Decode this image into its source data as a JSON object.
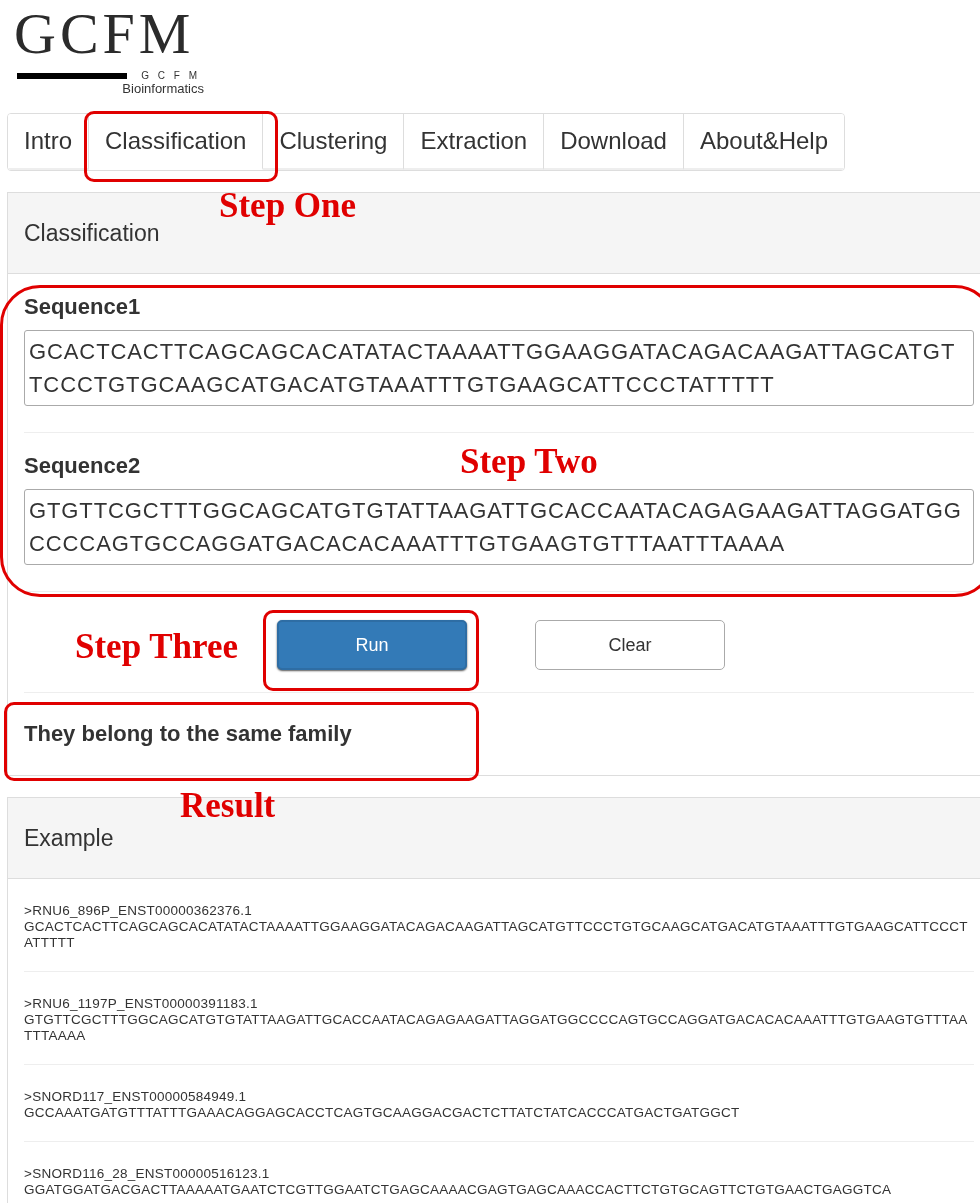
{
  "logo": {
    "mark": "GCFM",
    "small": "G C F M",
    "subtitle": "Bioinformatics"
  },
  "tabs": [
    {
      "label": "Intro",
      "selected": false
    },
    {
      "label": "Classification",
      "selected": true
    },
    {
      "label": "Clustering",
      "selected": false
    },
    {
      "label": "Extraction",
      "selected": false
    },
    {
      "label": "Download",
      "selected": false
    },
    {
      "label": "About&Help",
      "selected": false
    }
  ],
  "classification_panel": {
    "title": "Classification",
    "sequences": [
      {
        "label": "Sequence1",
        "value": "GCACTCACTTCAGCAGCACATATACTAAAATTGGAAGGATACAGACAAGATTAGCATGTTCCCTGTGCAAGCATGACATGTAAATTTGTGAAGCATTCCCTATTTTT"
      },
      {
        "label": "Sequence2",
        "value": "GTGTTCGCTTTGGCAGCATGTGTATTAAGATTGCACCAATACAGAGAAGATTAGGATGGCCCCAGTGCCAGGATGACACACAAATTTGTGAAGTGTTTAATTTAAAA"
      }
    ],
    "buttons": [
      {
        "label": "Run",
        "kind": "primary"
      },
      {
        "label": "Clear",
        "kind": "default"
      }
    ],
    "result": "They belong to the same family"
  },
  "example_panel": {
    "title": "Example",
    "items": [
      {
        "name": ">RNU6_896P_ENST00000362376.1",
        "sequence": "GCACTCACTTCAGCAGCACATATACTAAAATTGGAAGGATACAGACAAGATTAGCATGTTCCCTGTGCAAGCATGACATGTAAATTTGTGAAGCATTCCCTATTTTT"
      },
      {
        "name": ">RNU6_1197P_ENST00000391183.1",
        "sequence": "GTGTTCGCTTTGGCAGCATGTGTATTAAGATTGCACCAATACAGAGAAGATTAGGATGGCCCCAGTGCCAGGATGACACACAAATTTGTGAAGTGTTTAATTTAAAA"
      },
      {
        "name": ">SNORD117_ENST00000584949.1",
        "sequence": "GCCAAATGATGTTTATTTGAAACAGGAGCACCTCAGTGCAAGGACGACTCTTATCTATCACCCATGACTGATGGCT"
      },
      {
        "name": ">SNORD116_28_ENST00000516123.1",
        "sequence": "GGATGGATGACGACTTAAAAATGAATCTCGTTGGAATCTGAGCAAAACGAGTGAGCAAACCACTTCTGTGCAGTTCTGTGAACTGAGGTCA"
      }
    ]
  },
  "annotations": {
    "labels": [
      "Step One",
      "Step Two",
      "Step Three",
      "Result"
    ]
  }
}
